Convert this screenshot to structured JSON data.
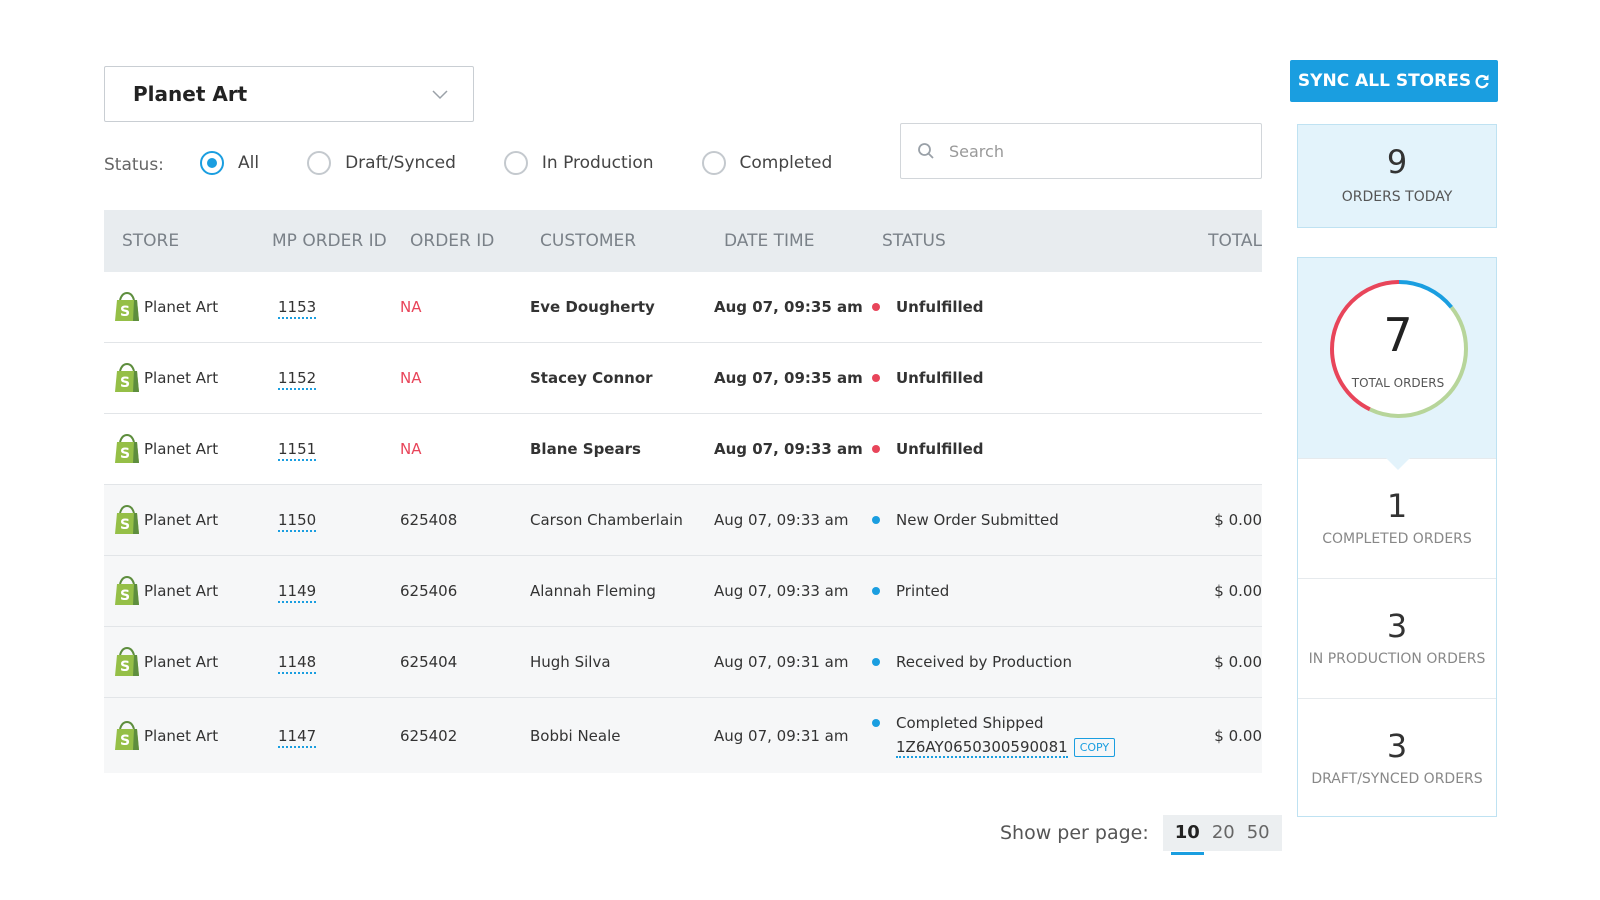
{
  "store_select": {
    "value": "Planet Art"
  },
  "status_filter": {
    "label": "Status:",
    "options": [
      "All",
      "Draft/Synced",
      "In Production",
      "Completed"
    ],
    "selected": "All"
  },
  "search": {
    "placeholder": "Search"
  },
  "table": {
    "columns": [
      "STORE",
      "MP ORDER ID",
      "ORDER ID",
      "CUSTOMER",
      "DATE TIME",
      "STATUS",
      "TOTAL"
    ],
    "rows": [
      {
        "store": "Planet Art",
        "mp_order_id": "1153",
        "order_id": "NA",
        "customer": "Eve Dougherty",
        "date_time": "Aug 07, 09:35 am",
        "status": "Unfulfilled",
        "status_color": "#e8455a",
        "total": ""
      },
      {
        "store": "Planet Art",
        "mp_order_id": "1152",
        "order_id": "NA",
        "customer": "Stacey Connor",
        "date_time": "Aug 07, 09:35 am",
        "status": "Unfulfilled",
        "status_color": "#e8455a",
        "total": ""
      },
      {
        "store": "Planet Art",
        "mp_order_id": "1151",
        "order_id": "NA",
        "customer": "Blane Spears",
        "date_time": "Aug 07, 09:33 am",
        "status": "Unfulfilled",
        "status_color": "#e8455a",
        "total": ""
      },
      {
        "store": "Planet Art",
        "mp_order_id": "1150",
        "order_id": "625408",
        "customer": "Carson Chamberlain",
        "date_time": "Aug 07, 09:33 am",
        "status": "New Order Submitted",
        "status_color": "#1a9ee0",
        "total": "$ 0.00"
      },
      {
        "store": "Planet Art",
        "mp_order_id": "1149",
        "order_id": "625406",
        "customer": "Alannah Fleming",
        "date_time": "Aug 07, 09:33 am",
        "status": "Printed",
        "status_color": "#1a9ee0",
        "total": "$ 0.00"
      },
      {
        "store": "Planet Art",
        "mp_order_id": "1148",
        "order_id": "625404",
        "customer": "Hugh Silva",
        "date_time": "Aug 07, 09:31 am",
        "status": "Received by Production",
        "status_color": "#1a9ee0",
        "total": "$ 0.00"
      },
      {
        "store": "Planet Art",
        "mp_order_id": "1147",
        "order_id": "625402",
        "customer": "Bobbi Neale",
        "date_time": "Aug 07, 09:31 am",
        "status": "Completed Shipped",
        "status_color": "#1a9ee0",
        "tracking": "1Z6AY0650300590081",
        "copy_label": "COPY",
        "total": "$ 0.00"
      }
    ]
  },
  "pagination": {
    "label": "Show per page:",
    "options": [
      "10",
      "20",
      "50"
    ],
    "selected": "10"
  },
  "sync_button": {
    "label": "SYNC ALL STORES"
  },
  "orders_today": {
    "value": "9",
    "label": "ORDERS TODAY"
  },
  "total_orders": {
    "value": "7",
    "label": "TOTAL ORDERS"
  },
  "stats": [
    {
      "value": "1",
      "label": "COMPLETED ORDERS"
    },
    {
      "value": "3",
      "label": "IN PRODUCTION ORDERS"
    },
    {
      "value": "3",
      "label": "DRAFT/SYNCED ORDERS"
    }
  ],
  "colors": {
    "accent": "#1a9ee0",
    "danger": "#e8455a",
    "success": "#b7d59a",
    "panel_bg": "#e3f3fb"
  },
  "icons": {
    "store": "shopify-bag-icon",
    "sync": "refresh-icon",
    "search": "search-icon",
    "dropdown": "chevron-down-icon"
  }
}
